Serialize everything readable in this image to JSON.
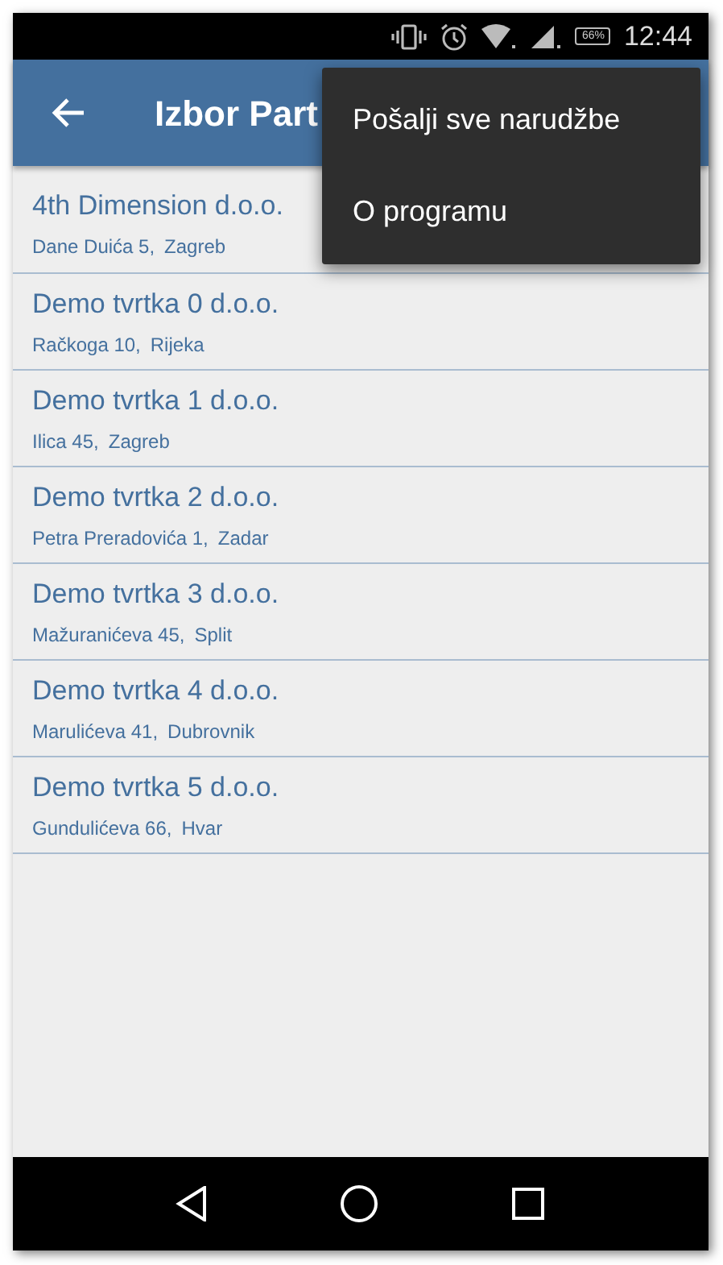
{
  "status_bar": {
    "battery": "66%",
    "time": "12:44"
  },
  "app_bar": {
    "title": "Izbor Part"
  },
  "menu": [
    {
      "label": "Pošalji sve narudžbe"
    },
    {
      "label": "O programu"
    }
  ],
  "partners": [
    {
      "name": "4th Dimension d.o.o.",
      "address": "Dane Duića 5,",
      "city": "Zagreb"
    },
    {
      "name": "Demo tvrtka 0 d.o.o.",
      "address": "Račkoga 10,",
      "city": "Rijeka"
    },
    {
      "name": "Demo tvrtka 1 d.o.o.",
      "address": "Ilica 45,",
      "city": "Zagreb"
    },
    {
      "name": "Demo tvrtka 2 d.o.o.",
      "address": "Petra Preradovića 1,",
      "city": "Zadar"
    },
    {
      "name": "Demo tvrtka 3 d.o.o.",
      "address": "Mažuranićeva 45,",
      "city": "Split"
    },
    {
      "name": "Demo tvrtka 4 d.o.o.",
      "address": "Marulićeva 41,",
      "city": "Dubrovnik"
    },
    {
      "name": "Demo tvrtka 5 d.o.o.",
      "address": "Gundulićeva 66,",
      "city": "Hvar"
    }
  ]
}
